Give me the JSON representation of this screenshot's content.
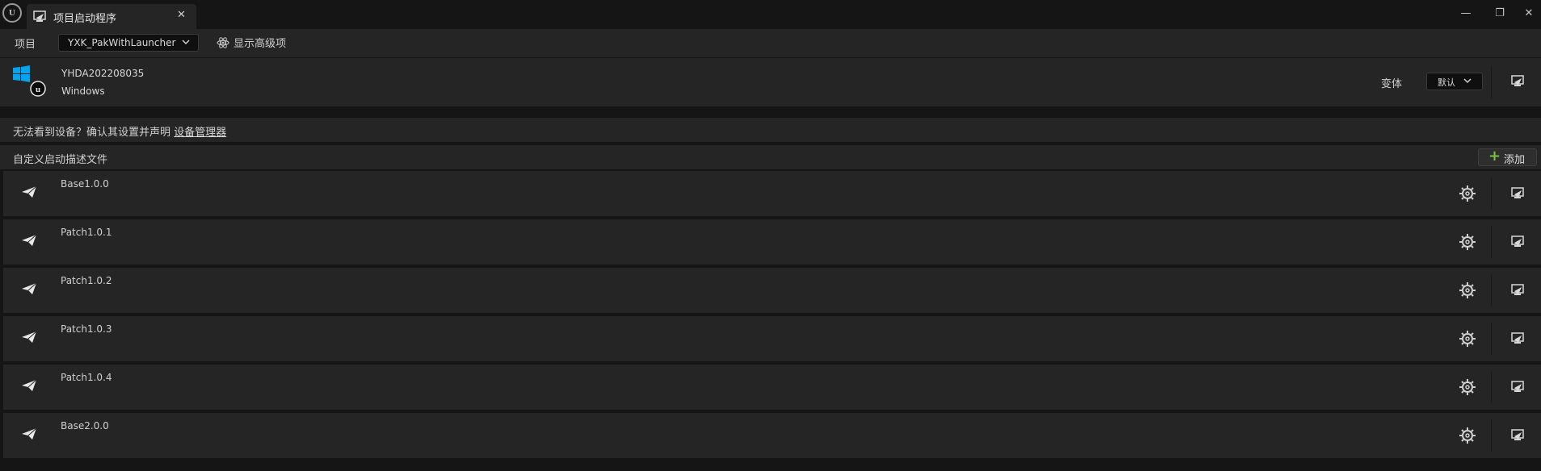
{
  "window": {
    "tab_title": "项目启动程序",
    "tab_close": "✕",
    "icons": {
      "app_logo": "unreal-logo-icon",
      "tab": "launcher-icon"
    },
    "controls": {
      "minimize": "—",
      "restore": "❐",
      "close": "✕"
    }
  },
  "toolbar": {
    "project_label": "项目",
    "project_value": "YXK_PakWithLauncher",
    "advanced_label": "显示高级项"
  },
  "device": {
    "name": "YHDA202208035",
    "os": "Windows",
    "variant_label": "变体",
    "variant_value": "默认"
  },
  "hint": {
    "text": "无法看到设备？确认其设置并声明 ",
    "link": "设备管理器"
  },
  "profiles": {
    "title": "自定义启动描述文件",
    "add_label": "添加",
    "items": [
      {
        "name": "Base1.0.0"
      },
      {
        "name": "Patch1.0.1"
      },
      {
        "name": "Patch1.0.2"
      },
      {
        "name": "Patch1.0.3"
      },
      {
        "name": "Patch1.0.4"
      },
      {
        "name": "Base2.0.0"
      }
    ]
  },
  "colors": {
    "background": "#151515",
    "panel": "#252525",
    "accent_add": "#7bc043",
    "windows_blue": "#00a4ef"
  }
}
